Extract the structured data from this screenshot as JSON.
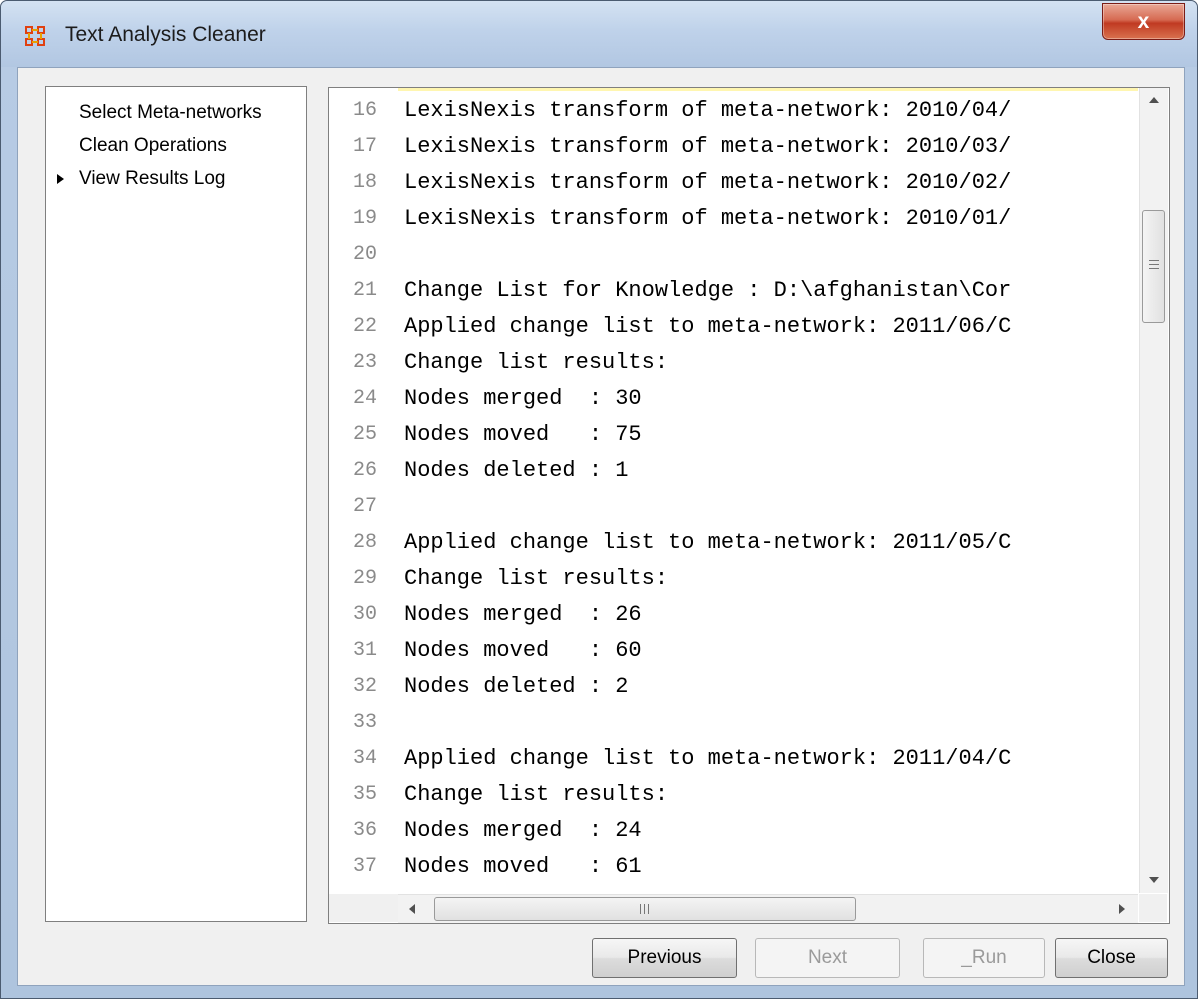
{
  "window": {
    "title": "Text Analysis Cleaner",
    "close_glyph": "x"
  },
  "sidebar": {
    "items": [
      {
        "label": "Select Meta-networks",
        "selected": false
      },
      {
        "label": "Clean Operations",
        "selected": false
      },
      {
        "label": "View Results Log",
        "selected": true
      }
    ]
  },
  "log": {
    "lines": [
      {
        "n": "16",
        "text": "LexisNexis transform of meta-network: 2010/04/"
      },
      {
        "n": "17",
        "text": "LexisNexis transform of meta-network: 2010/03/"
      },
      {
        "n": "18",
        "text": "LexisNexis transform of meta-network: 2010/02/"
      },
      {
        "n": "19",
        "text": "LexisNexis transform of meta-network: 2010/01/"
      },
      {
        "n": "20",
        "text": ""
      },
      {
        "n": "21",
        "text": "Change List for Knowledge : D:\\afghanistan\\Cor"
      },
      {
        "n": "22",
        "text": "Applied change list to meta-network: 2011/06/C"
      },
      {
        "n": "23",
        "text": "Change list results:"
      },
      {
        "n": "24",
        "text": "Nodes merged  : 30"
      },
      {
        "n": "25",
        "text": "Nodes moved   : 75"
      },
      {
        "n": "26",
        "text": "Nodes deleted : 1"
      },
      {
        "n": "27",
        "text": ""
      },
      {
        "n": "28",
        "text": "Applied change list to meta-network: 2011/05/C"
      },
      {
        "n": "29",
        "text": "Change list results:"
      },
      {
        "n": "30",
        "text": "Nodes merged  : 26"
      },
      {
        "n": "31",
        "text": "Nodes moved   : 60"
      },
      {
        "n": "32",
        "text": "Nodes deleted : 2"
      },
      {
        "n": "33",
        "text": ""
      },
      {
        "n": "34",
        "text": "Applied change list to meta-network: 2011/04/C"
      },
      {
        "n": "35",
        "text": "Change list results:"
      },
      {
        "n": "36",
        "text": "Nodes merged  : 24"
      },
      {
        "n": "37",
        "text": "Nodes moved   : 61"
      }
    ]
  },
  "buttons": {
    "previous": "Previous",
    "next": "Next",
    "run": "_Run",
    "close": "Close"
  },
  "colors": {
    "title_bar": "#bfd2ea",
    "close_button": "#c8452c",
    "panel_bg": "#f0f0f0"
  },
  "icons": {
    "app": "network-grid-icon",
    "nav_current": "triangle-right-icon"
  }
}
